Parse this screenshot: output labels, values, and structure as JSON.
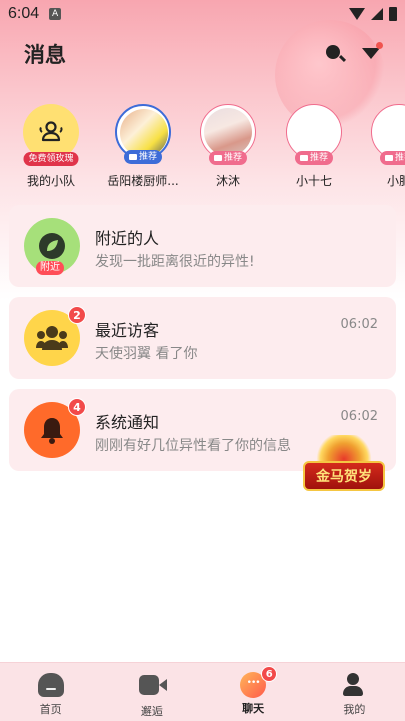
{
  "status_bar": {
    "time": "6:04",
    "notification_letter": "A"
  },
  "header": {
    "title": "消息"
  },
  "stories": [
    {
      "name": "我的小队",
      "tag": "免费领玫瑰"
    },
    {
      "name": "岳阳楼厨师...",
      "tag": "推荐"
    },
    {
      "name": "沐沐",
      "tag": "推荐"
    },
    {
      "name": "小十七",
      "tag": "推荐"
    },
    {
      "name": "小肥",
      "tag": "推荐"
    }
  ],
  "cards": {
    "nearby": {
      "title": "附近的人",
      "subtitle": "发现一批距离很近的异性!",
      "tag": "附近"
    },
    "visitors": {
      "title": "最近访客",
      "subtitle": "天使羽翼 看了你",
      "time": "06:02",
      "badge": "2"
    },
    "system": {
      "title": "系统通知",
      "subtitle": "刚刚有好几位异性看了你的信息",
      "time": "06:02",
      "badge": "4"
    }
  },
  "promo": {
    "text": "金马贺岁"
  },
  "tabbar": {
    "items": [
      {
        "label": "首页",
        "icon": "home-icon"
      },
      {
        "label": "邂逅",
        "icon": "video-icon"
      },
      {
        "label": "聊天",
        "icon": "chat-icon",
        "badge": "6"
      },
      {
        "label": "我的",
        "icon": "profile-icon"
      }
    ]
  },
  "colors": {
    "accent": "#f06c8d",
    "card_bg": "#fdecee",
    "badge": "#f24a4a",
    "header_gradient_top": "#f8a6b0"
  }
}
